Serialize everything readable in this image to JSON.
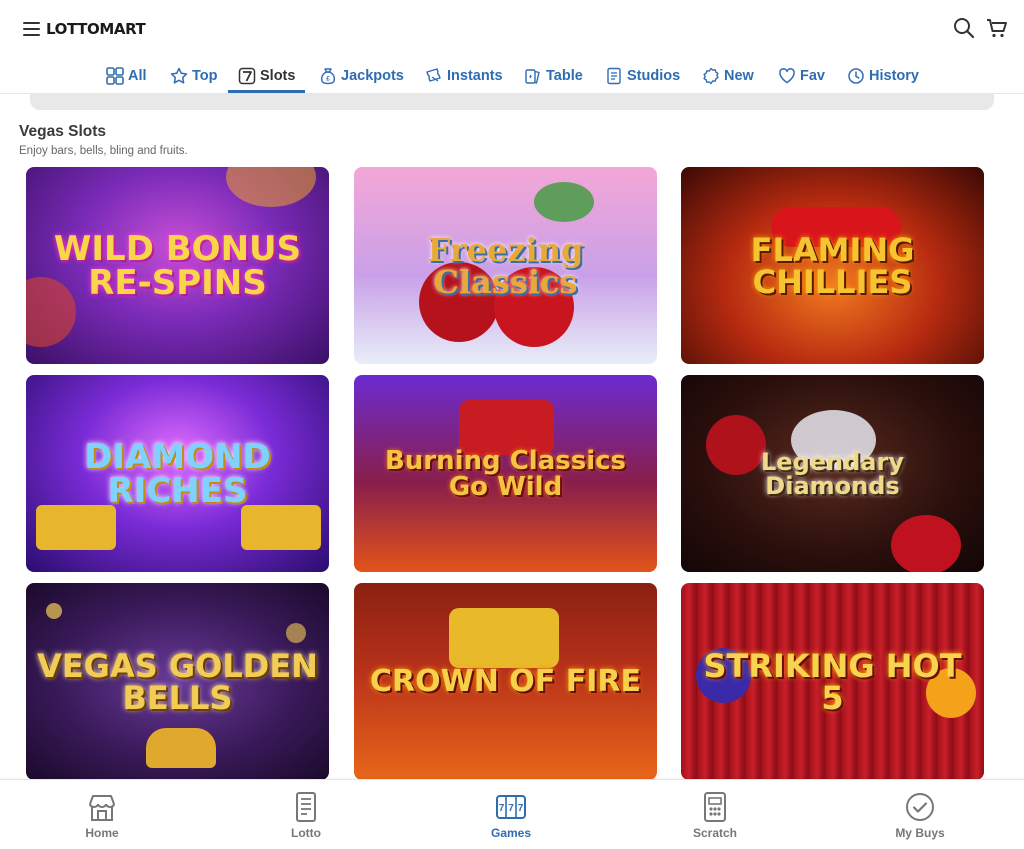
{
  "header": {
    "logo_text": "LOTTOMART"
  },
  "tabs": [
    {
      "label": "All",
      "icon": "grid-icon"
    },
    {
      "label": "Top",
      "icon": "star-icon"
    },
    {
      "label": "Slots",
      "icon": "seven-icon",
      "active": true
    },
    {
      "label": "Jackpots",
      "icon": "money-bag-icon"
    },
    {
      "label": "Instants",
      "icon": "ticket-icon"
    },
    {
      "label": "Table",
      "icon": "cards-icon"
    },
    {
      "label": "Studios",
      "icon": "document-icon"
    },
    {
      "label": "New",
      "icon": "badge-icon"
    },
    {
      "label": "Fav",
      "icon": "heart-icon"
    },
    {
      "label": "History",
      "icon": "clock-icon"
    }
  ],
  "section": {
    "title": "Vegas Slots",
    "subtitle": "Enjoy bars, bells, bling and fruits."
  },
  "games": [
    {
      "title": "Wild Bonus Re-Spins",
      "accent": "#f7d64a"
    },
    {
      "title": "Freezing Classics",
      "accent": "#e8a93a"
    },
    {
      "title": "Flaming Chillies",
      "accent": "#f5c430"
    },
    {
      "title": "Diamond Riches",
      "accent": "#7fd1ff"
    },
    {
      "title": "Burning Classics Go Wild",
      "accent": "#f4c542"
    },
    {
      "title": "Legendary Diamonds",
      "accent": "#f0d98a"
    },
    {
      "title": "Vegas Golden Bells",
      "accent": "#f3cc55"
    },
    {
      "title": "Crown of Fire",
      "accent": "#f6d24a"
    },
    {
      "title": "Striking Hot 5",
      "accent": "#f7d34e"
    }
  ],
  "bottom_nav": [
    {
      "label": "Home",
      "icon": "home-icon"
    },
    {
      "label": "Lotto",
      "icon": "lotto-icon"
    },
    {
      "label": "Games",
      "icon": "slot-machine-icon",
      "active": true
    },
    {
      "label": "Scratch",
      "icon": "scratch-card-icon"
    },
    {
      "label": "My Buys",
      "icon": "check-circle-icon"
    }
  ]
}
